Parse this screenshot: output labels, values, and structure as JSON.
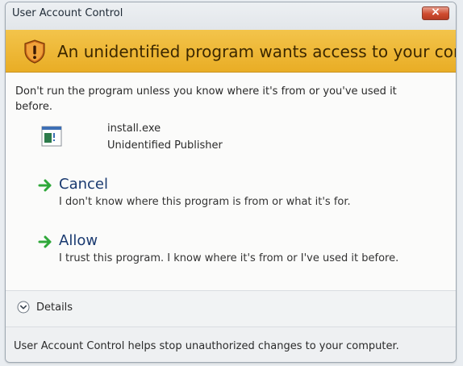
{
  "window": {
    "title": "User Account Control",
    "close_label": "×"
  },
  "banner": {
    "icon": "shield-warning-icon",
    "text": "An unidentified program wants access to your computer"
  },
  "message": {
    "warning": "Don't run the program unless you know where it's from or you've used it before."
  },
  "program": {
    "icon": "program-icon",
    "name": "install.exe",
    "publisher": "Unidentified Publisher"
  },
  "options": [
    {
      "title": "Cancel",
      "description": "I don't know where this program is from or what it's for.",
      "icon": "green-arrow-icon"
    },
    {
      "title": "Allow",
      "description": "I trust this program. I know where it's from or I've used it before.",
      "icon": "green-arrow-icon"
    }
  ],
  "details": {
    "label": "Details",
    "icon": "chevron-down-icon"
  },
  "footer": {
    "text": "User Account Control helps stop unauthorized changes to your computer."
  },
  "colors": {
    "banner": "#e9ad25",
    "option_title": "#1a3a70",
    "arrow": "#2fa83a",
    "close_button": "#cf4b2f"
  }
}
